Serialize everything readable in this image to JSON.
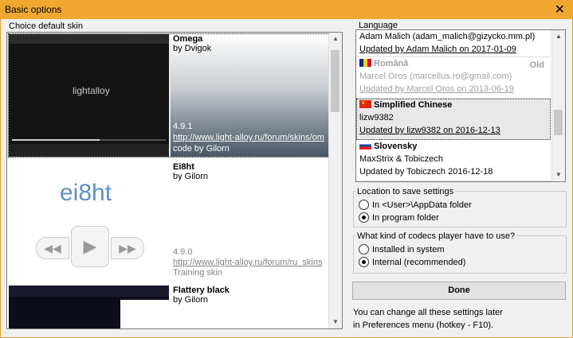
{
  "window": {
    "title": "Basic options",
    "close": "✕"
  },
  "skins": {
    "label": "Choice default skin",
    "items": [
      {
        "name": "Omega",
        "author": "by Dvigok",
        "version": "4.9.1",
        "link": "http://www.light-alloy.ru/forum/skins/om",
        "code": "code by Gilorn",
        "preview_text": "lightalloy"
      },
      {
        "name": "Ei8ht",
        "author": "by Gilorn",
        "version": "4.9.0",
        "link": "http://www.light-alloy.ru/forum/ru_skins",
        "code": "Training skin",
        "preview_text": "ei8ht"
      },
      {
        "name": "Flattery black",
        "author": "by Gilorn"
      }
    ]
  },
  "language": {
    "label": "Language",
    "items": [
      {
        "line1": "Adam Malich (adam_malich@gizycko.mm.pl)",
        "updated": "Updated by Adam Malich on 2017-01-09"
      },
      {
        "name": "Română",
        "author": "Marcel Oros (marcellus.ro@gmail.com)",
        "updated": "Updated by Marcel Oros on 2013-06-19",
        "badge": "Old"
      },
      {
        "name": "Simplified Chinese",
        "author": "lizw9382",
        "updated": "Updated by lizw9382 on 2016-12-13"
      },
      {
        "name": "Slovensky",
        "author": "MaxStrix & Tobiczech",
        "updated": "Updated by Tobiczech 2016-12-18"
      }
    ]
  },
  "save_location": {
    "label": "Location to save settings",
    "options": [
      "In <User>\\AppData folder",
      "In program folder"
    ],
    "selected": 1
  },
  "codecs": {
    "label": "What kind of codecs player have to use?",
    "options": [
      "Installed in system",
      "Internal (recommended)"
    ],
    "selected": 1
  },
  "done_label": "Done",
  "note": [
    "You can change all these settings later",
    "in Preferences menu (hotkey - F10)."
  ]
}
